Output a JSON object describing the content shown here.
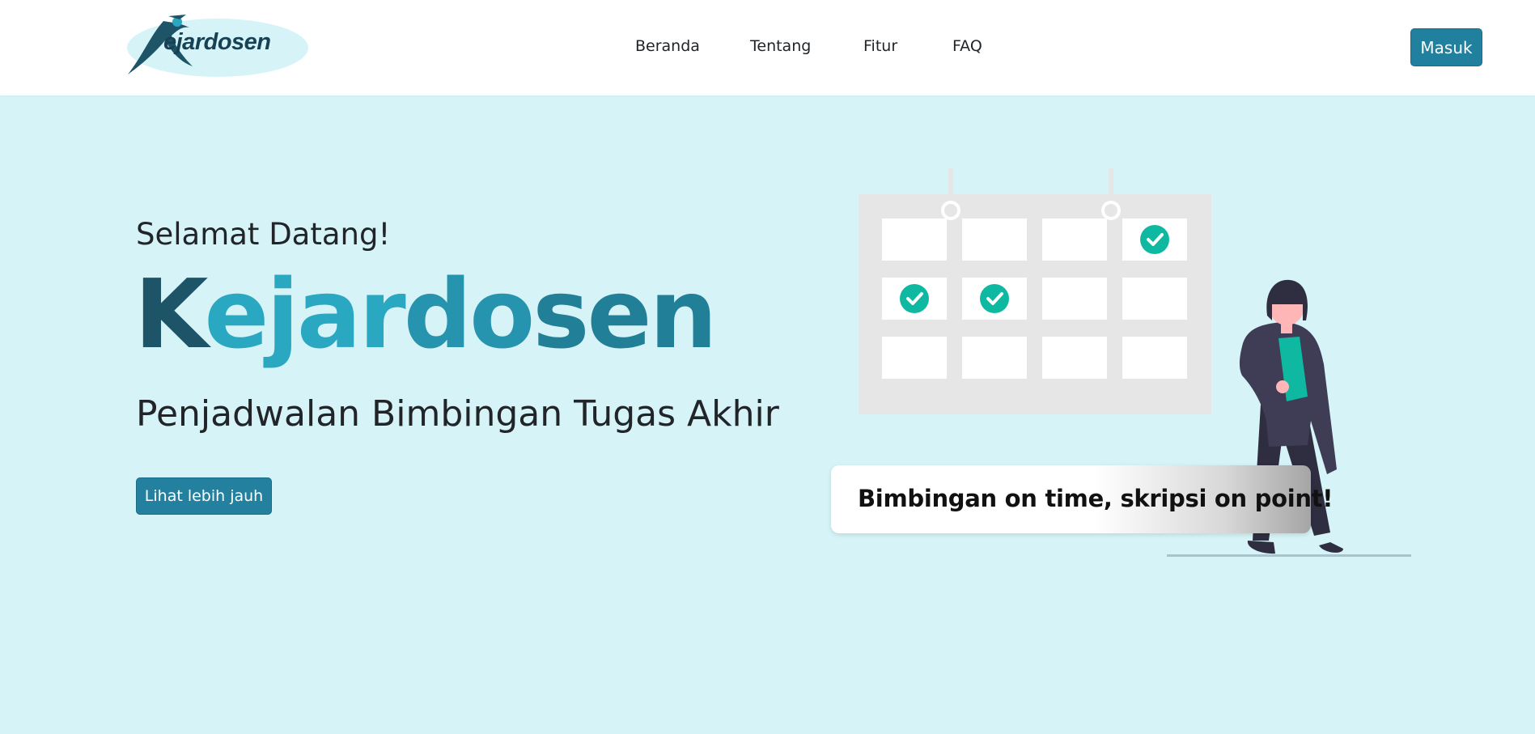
{
  "brand": {
    "logo_text": "ejardosen",
    "logo_alt": "Kejardosen"
  },
  "nav": {
    "items": [
      {
        "label": "Beranda"
      },
      {
        "label": "Tentang"
      },
      {
        "label": "Fitur"
      },
      {
        "label": "FAQ"
      }
    ],
    "login_label": "Masuk"
  },
  "hero": {
    "greeting": "Selamat Datang!",
    "title_parts": [
      "K",
      "ejar",
      "do",
      "sen"
    ],
    "subtitle": "Penjadwalan Bimbingan Tugas Akhir",
    "cta_label": "Lihat lebih jauh",
    "tagline": "Bimbingan on time, skripsi on point!"
  },
  "calendar": {
    "rows": 3,
    "cols": 4,
    "checked_cells": [
      [
        0,
        3
      ],
      [
        1,
        0
      ],
      [
        1,
        1
      ]
    ]
  },
  "colors": {
    "background": "#d6f4f7",
    "primary": "#22809f",
    "check": "#0fb8a0",
    "brand_dark": "#1e5468",
    "brand_light": "#2aa7c1"
  }
}
